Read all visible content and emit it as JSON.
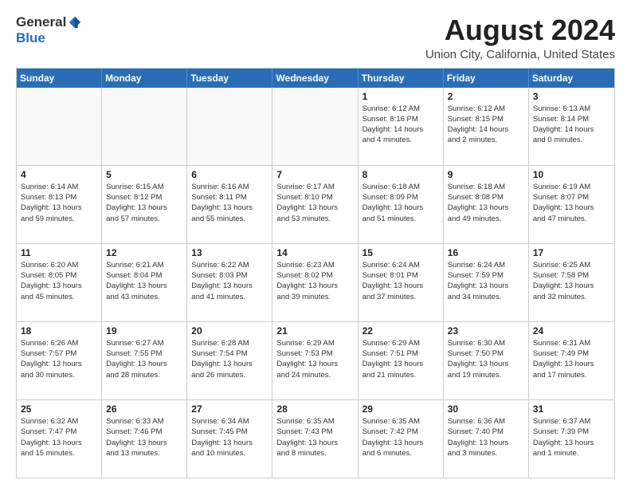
{
  "logo": {
    "general": "General",
    "blue": "Blue"
  },
  "title": "August 2024",
  "subtitle": "Union City, California, United States",
  "days_of_week": [
    "Sunday",
    "Monday",
    "Tuesday",
    "Wednesday",
    "Thursday",
    "Friday",
    "Saturday"
  ],
  "weeks": [
    [
      {
        "day": "",
        "info": "",
        "shaded": true
      },
      {
        "day": "",
        "info": "",
        "shaded": true
      },
      {
        "day": "",
        "info": "",
        "shaded": true
      },
      {
        "day": "",
        "info": "",
        "shaded": true
      },
      {
        "day": "1",
        "info": "Sunrise: 6:12 AM\nSunset: 8:16 PM\nDaylight: 14 hours\nand 4 minutes."
      },
      {
        "day": "2",
        "info": "Sunrise: 6:12 AM\nSunset: 8:15 PM\nDaylight: 14 hours\nand 2 minutes."
      },
      {
        "day": "3",
        "info": "Sunrise: 6:13 AM\nSunset: 8:14 PM\nDaylight: 14 hours\nand 0 minutes."
      }
    ],
    [
      {
        "day": "4",
        "info": "Sunrise: 6:14 AM\nSunset: 8:13 PM\nDaylight: 13 hours\nand 59 minutes."
      },
      {
        "day": "5",
        "info": "Sunrise: 6:15 AM\nSunset: 8:12 PM\nDaylight: 13 hours\nand 57 minutes."
      },
      {
        "day": "6",
        "info": "Sunrise: 6:16 AM\nSunset: 8:11 PM\nDaylight: 13 hours\nand 55 minutes."
      },
      {
        "day": "7",
        "info": "Sunrise: 6:17 AM\nSunset: 8:10 PM\nDaylight: 13 hours\nand 53 minutes."
      },
      {
        "day": "8",
        "info": "Sunrise: 6:18 AM\nSunset: 8:09 PM\nDaylight: 13 hours\nand 51 minutes."
      },
      {
        "day": "9",
        "info": "Sunrise: 6:18 AM\nSunset: 8:08 PM\nDaylight: 13 hours\nand 49 minutes."
      },
      {
        "day": "10",
        "info": "Sunrise: 6:19 AM\nSunset: 8:07 PM\nDaylight: 13 hours\nand 47 minutes."
      }
    ],
    [
      {
        "day": "11",
        "info": "Sunrise: 6:20 AM\nSunset: 8:05 PM\nDaylight: 13 hours\nand 45 minutes."
      },
      {
        "day": "12",
        "info": "Sunrise: 6:21 AM\nSunset: 8:04 PM\nDaylight: 13 hours\nand 43 minutes."
      },
      {
        "day": "13",
        "info": "Sunrise: 6:22 AM\nSunset: 8:03 PM\nDaylight: 13 hours\nand 41 minutes."
      },
      {
        "day": "14",
        "info": "Sunrise: 6:23 AM\nSunset: 8:02 PM\nDaylight: 13 hours\nand 39 minutes."
      },
      {
        "day": "15",
        "info": "Sunrise: 6:24 AM\nSunset: 8:01 PM\nDaylight: 13 hours\nand 37 minutes."
      },
      {
        "day": "16",
        "info": "Sunrise: 6:24 AM\nSunset: 7:59 PM\nDaylight: 13 hours\nand 34 minutes."
      },
      {
        "day": "17",
        "info": "Sunrise: 6:25 AM\nSunset: 7:58 PM\nDaylight: 13 hours\nand 32 minutes."
      }
    ],
    [
      {
        "day": "18",
        "info": "Sunrise: 6:26 AM\nSunset: 7:57 PM\nDaylight: 13 hours\nand 30 minutes."
      },
      {
        "day": "19",
        "info": "Sunrise: 6:27 AM\nSunset: 7:55 PM\nDaylight: 13 hours\nand 28 minutes."
      },
      {
        "day": "20",
        "info": "Sunrise: 6:28 AM\nSunset: 7:54 PM\nDaylight: 13 hours\nand 26 minutes."
      },
      {
        "day": "21",
        "info": "Sunrise: 6:29 AM\nSunset: 7:53 PM\nDaylight: 13 hours\nand 24 minutes."
      },
      {
        "day": "22",
        "info": "Sunrise: 6:29 AM\nSunset: 7:51 PM\nDaylight: 13 hours\nand 21 minutes."
      },
      {
        "day": "23",
        "info": "Sunrise: 6:30 AM\nSunset: 7:50 PM\nDaylight: 13 hours\nand 19 minutes."
      },
      {
        "day": "24",
        "info": "Sunrise: 6:31 AM\nSunset: 7:49 PM\nDaylight: 13 hours\nand 17 minutes."
      }
    ],
    [
      {
        "day": "25",
        "info": "Sunrise: 6:32 AM\nSunset: 7:47 PM\nDaylight: 13 hours\nand 15 minutes."
      },
      {
        "day": "26",
        "info": "Sunrise: 6:33 AM\nSunset: 7:46 PM\nDaylight: 13 hours\nand 13 minutes."
      },
      {
        "day": "27",
        "info": "Sunrise: 6:34 AM\nSunset: 7:45 PM\nDaylight: 13 hours\nand 10 minutes."
      },
      {
        "day": "28",
        "info": "Sunrise: 6:35 AM\nSunset: 7:43 PM\nDaylight: 13 hours\nand 8 minutes."
      },
      {
        "day": "29",
        "info": "Sunrise: 6:35 AM\nSunset: 7:42 PM\nDaylight: 13 hours\nand 6 minutes."
      },
      {
        "day": "30",
        "info": "Sunrise: 6:36 AM\nSunset: 7:40 PM\nDaylight: 13 hours\nand 3 minutes."
      },
      {
        "day": "31",
        "info": "Sunrise: 6:37 AM\nSunset: 7:39 PM\nDaylight: 13 hours\nand 1 minute."
      }
    ]
  ]
}
